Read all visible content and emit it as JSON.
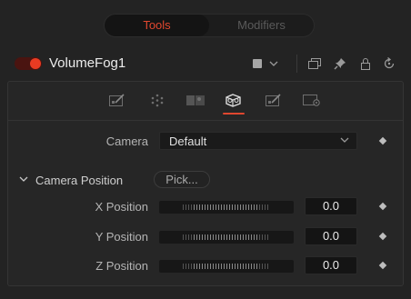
{
  "tabs": {
    "tools": "Tools",
    "modifiers": "Modifiers"
  },
  "node": {
    "name": "VolumeFog1",
    "enabled": true
  },
  "header_icons": [
    "color-swatch-icon",
    "chevron-down-icon",
    "window-icon",
    "pin-icon",
    "lock-icon",
    "reset-icon"
  ],
  "inspector_tabs": [
    {
      "icon": "controls-tab-icon",
      "active": false
    },
    {
      "icon": "particles-tab-icon",
      "active": false
    },
    {
      "icon": "image-tab-icon",
      "active": false
    },
    {
      "icon": "camera-3d-tab-icon",
      "active": true
    },
    {
      "icon": "controls2-tab-icon",
      "active": false
    },
    {
      "icon": "settings-tab-icon",
      "active": false
    }
  ],
  "camera": {
    "label": "Camera",
    "value": "Default"
  },
  "camera_position": {
    "label": "Camera Position",
    "pick_label": "Pick...",
    "fields": [
      {
        "label": "X Position",
        "value": "0.0"
      },
      {
        "label": "Y Position",
        "value": "0.0"
      },
      {
        "label": "Z Position",
        "value": "0.0"
      }
    ]
  },
  "colors": {
    "accent": "#e0472f",
    "toggle_on": "#ea3b22",
    "panel_bg": "#262626",
    "field_bg": "#141414"
  }
}
